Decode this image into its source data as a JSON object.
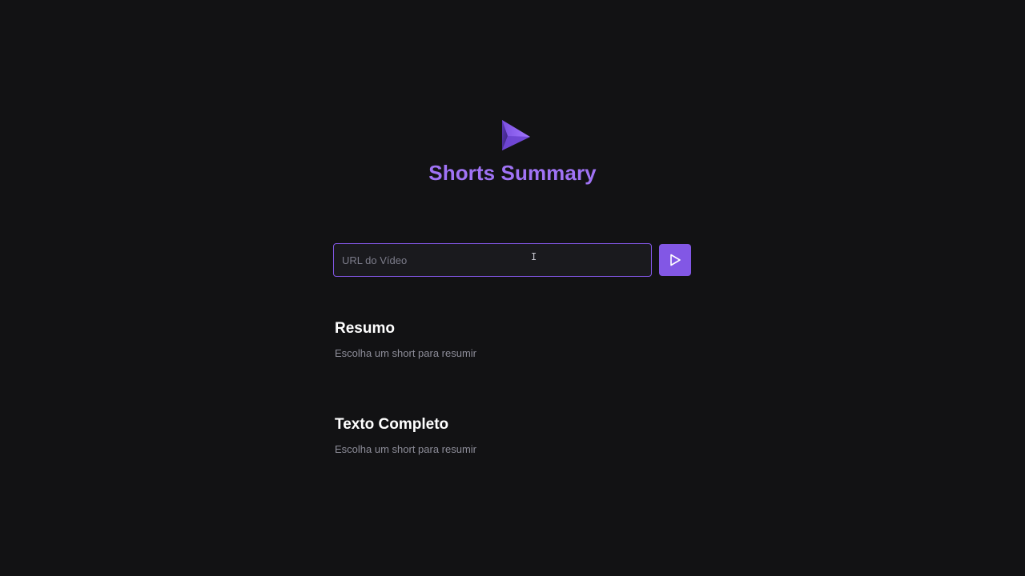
{
  "header": {
    "logo_icon": "play-logo-icon",
    "title": "Shorts Summary"
  },
  "form": {
    "url_placeholder": "URL do Vídeo",
    "url_value": "",
    "submit_icon": "play-icon"
  },
  "summary": {
    "title": "Resumo",
    "text": "Escolha um short para resumir"
  },
  "full_text": {
    "title": "Texto Completo",
    "text": "Escolha um short para resumir"
  },
  "colors": {
    "background": "#121214",
    "accent": "#8257e5",
    "title": "#a073f5",
    "muted_text": "#8d8d99"
  }
}
